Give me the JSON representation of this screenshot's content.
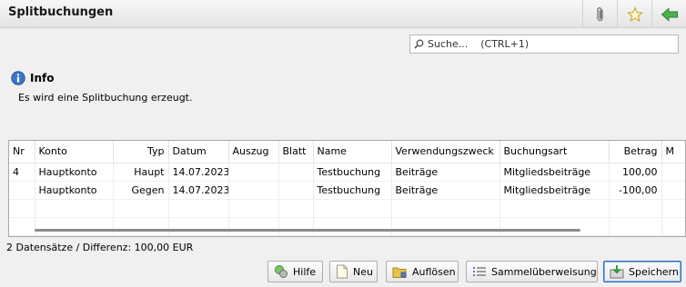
{
  "window": {
    "title": "Splitbuchungen"
  },
  "toolbar": {
    "attach_icon": "paperclip-icon",
    "favorite_icon": "star-icon",
    "back_icon": "back-arrow-icon"
  },
  "search": {
    "placeholder": "Suche...    (CTRL+1)"
  },
  "info": {
    "title": "Info",
    "message": "Es wird eine Splitbuchung erzeugt."
  },
  "table": {
    "headers": [
      "Nr",
      "Konto",
      "Typ",
      "Datum",
      "Auszug",
      "Blatt",
      "Name",
      "Verwendungszweck",
      "Buchungsart",
      "Betrag",
      "M"
    ],
    "rows": [
      {
        "nr": "4",
        "konto": "Hauptkonto",
        "typ": "Haupt",
        "datum": "14.07.2023",
        "auszug": "",
        "blatt": "",
        "name": "Testbuchung",
        "zweck": "Beiträge",
        "art": "Mitgliedsbeiträge",
        "betrag": "100,00"
      },
      {
        "nr": "",
        "konto": "Hauptkonto",
        "typ": "Gegen",
        "datum": "14.07.2023",
        "auszug": "",
        "blatt": "",
        "name": "Testbuchung",
        "zweck": "Beiträge",
        "art": "Mitgliedsbeiträge",
        "betrag": "-100,00"
      }
    ]
  },
  "status": "2 Datensätze / Differenz: 100,00 EUR",
  "buttons": {
    "help": "Hilfe",
    "new": "Neu",
    "dissolve": "Auflösen",
    "bulk_transfer": "Sammelüberweisung",
    "save": "Speichern"
  },
  "colors": {
    "accent": "#2e6bc4",
    "back_arrow": "#3aa23a"
  }
}
